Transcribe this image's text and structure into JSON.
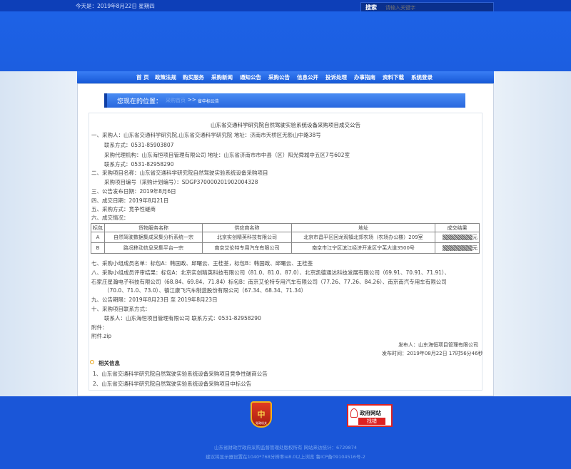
{
  "topbar": {
    "date": "今天是：2019年8月22日 星期四",
    "search_button": "搜索",
    "search_placeholder": "请输入关键字"
  },
  "nav": {
    "items": [
      "首 页",
      "政策法规",
      "购买服务",
      "采购新闻",
      "通知公告",
      "采购公告",
      "信息公开",
      "投诉处理",
      "办事指南",
      "资料下载",
      "系统登录"
    ]
  },
  "breadcrumb": {
    "label": "您现在的位置：",
    "home": "采购首页",
    "sep": ">>",
    "current": "省中标公告"
  },
  "article": {
    "title": "山东省交通科学研究院自然驾驶实验系统设备采购项目成交公告",
    "lines": [
      "一、采购人：山东省交通科学研究院,山东省交通科学研究院    地址：济南市天桥区无影山中路38号",
      "联系方式：0531-85903807",
      "采购代理机构：山东海恒项目管理有限公司    地址：山东省济南市市中县（区）阳光舜城中五区7号602室",
      "联系方式：0531-82958290",
      "二、采购项目名称：山东省交通科学研究院自然驾驶实验系统设备采购项目",
      "采购项目编号（采购计划编号）：SDGP370000201902004328",
      "三、公告发布日期：2019年8月6日",
      "四、成交日期：2019年8月21日",
      "五、采购方式：竞争性磋商",
      "六、成交情况："
    ],
    "table": {
      "headers": [
        "标包",
        "货物服务名称",
        "供应商名称",
        "地址",
        "成交结果"
      ],
      "rows": [
        [
          "A",
          "自然驾驶数据集成采集分析系统一宗",
          "北京实创精英科技有限公司",
          "北京市昌平区回龙观镇北郊农场（农场办公楼）209室",
          "元"
        ],
        [
          "B",
          "路况移动信息采集平台一宗",
          "南京艾伦特专用汽车有限公司",
          "南京市江宁区滨江经济开发区宁芜大道3500号",
          "元"
        ]
      ]
    },
    "lines2": [
      "七、采购小组成员名单：标包A：韩国政、邱曙云、王桂荃，标包B：韩国政、邱曙云、王桂荃",
      "八、采购小组成员评审结果：标包A：北京实创精英科技有限公司（81.0、81.0、87.0）、北京凯德通达科技发展有限公司（69.91、70.91、71.91）、",
      "石家庄星瀚电子科技有限公司（68.84、69.84、71.84）标包B：南京艾伦特专用汽车有限公司（77.26、77.26、84.26）、南京南汽专用车有限公司",
      "（70.0、71.0、73.0）、镇江康飞汽车制造股份有限公司（67.34、68.34、71.34）",
      "九、公告期限：2019年8月23日 至 2019年8月23日",
      "十、采购项目联系方式：",
      "联系人：山东海恒项目管理有限公司        联系方式：0531-82958290",
      "附件：",
      "附件.zip"
    ],
    "publisher": "发布人：山东海恒项目管理有限公司",
    "publish_time": "发布时间：2019年08月22日 17时56分46秒",
    "related_title": "相关信息",
    "related": [
      "1、山东省交通科学研究院自然驾驶实验系统设备采购项目竞争性磋商公告",
      "2、山东省交通科学研究院自然驾驶实验系统设备采购项目中标公告"
    ]
  },
  "footer": {
    "emblem_text": "党政机关",
    "gov_badge_line1": "政府网站",
    "gov_badge_line2": "找错",
    "line1": "山东省财政厅政府采购监督管理处版权所有      网站来访统计：6729874",
    "line2": "建议将显示器设置在1040*768分辨率ie8.0以上浏览 鲁ICP备09104516号-2"
  }
}
